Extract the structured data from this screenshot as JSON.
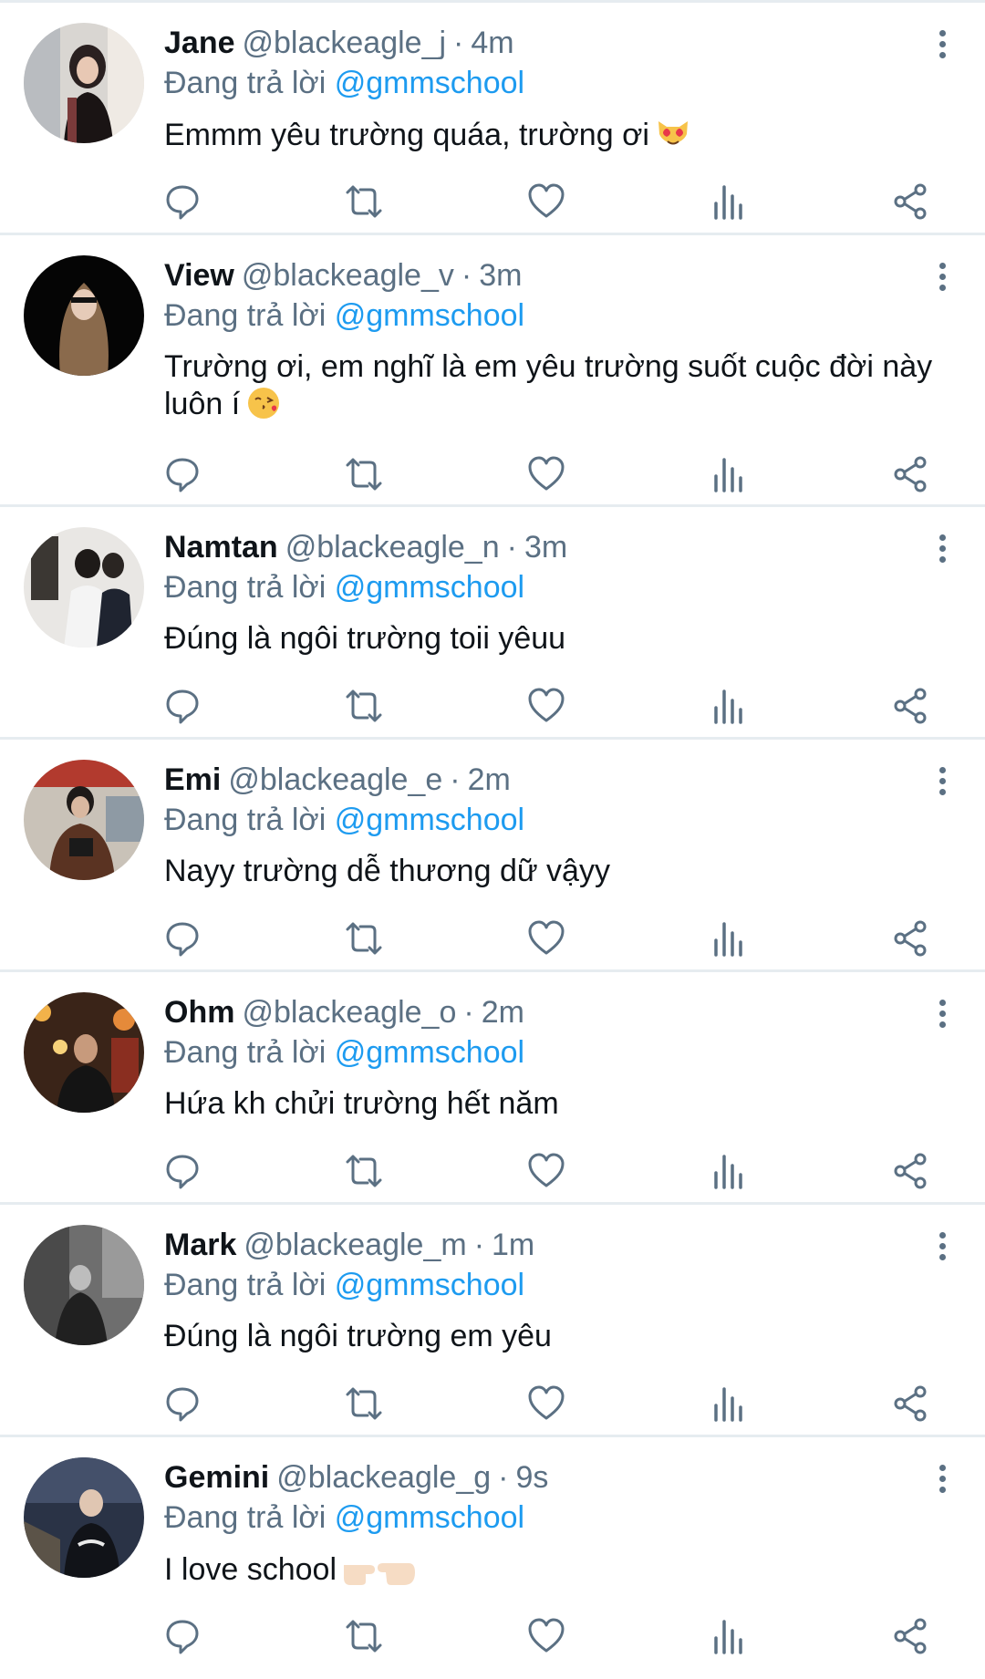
{
  "replying_label": "Đang trả lời",
  "replying_to": "@gmmschool",
  "tweets": [
    {
      "name": "Jane",
      "handle": "@blackeagle_j",
      "time": "4m",
      "text": "Emmm yêu trường quáa, trường ơi",
      "emoji": "heart-eyes-cat-emoji"
    },
    {
      "name": "View",
      "handle": "@blackeagle_v",
      "time": "3m",
      "text": "Trường ơi, em nghĩ là em yêu trường suốt cuộc đời này luôn í",
      "emoji": "kissing-face-emoji"
    },
    {
      "name": "Namtan",
      "handle": "@blackeagle_n",
      "time": "3m",
      "text": "Đúng là ngôi trường toii yêuu",
      "emoji": ""
    },
    {
      "name": "Emi",
      "handle": "@blackeagle_e",
      "time": "2m",
      "text": "Nayy trường dễ thương dữ vậyy",
      "emoji": ""
    },
    {
      "name": "Ohm",
      "handle": "@blackeagle_o",
      "time": "2m",
      "text": "Hứa kh chửi trường hết năm",
      "emoji": ""
    },
    {
      "name": "Mark",
      "handle": "@blackeagle_m",
      "time": "1m",
      "text": "Đúng là ngôi trường em yêu",
      "emoji": ""
    },
    {
      "name": "Gemini",
      "handle": "@blackeagle_g",
      "time": "9s",
      "text": "I love school",
      "emoji": "pointing-hands-emoji"
    }
  ],
  "colors": {
    "link": "#1d9bf0",
    "muted": "#5b7083",
    "divider": "#e6ecf0"
  }
}
